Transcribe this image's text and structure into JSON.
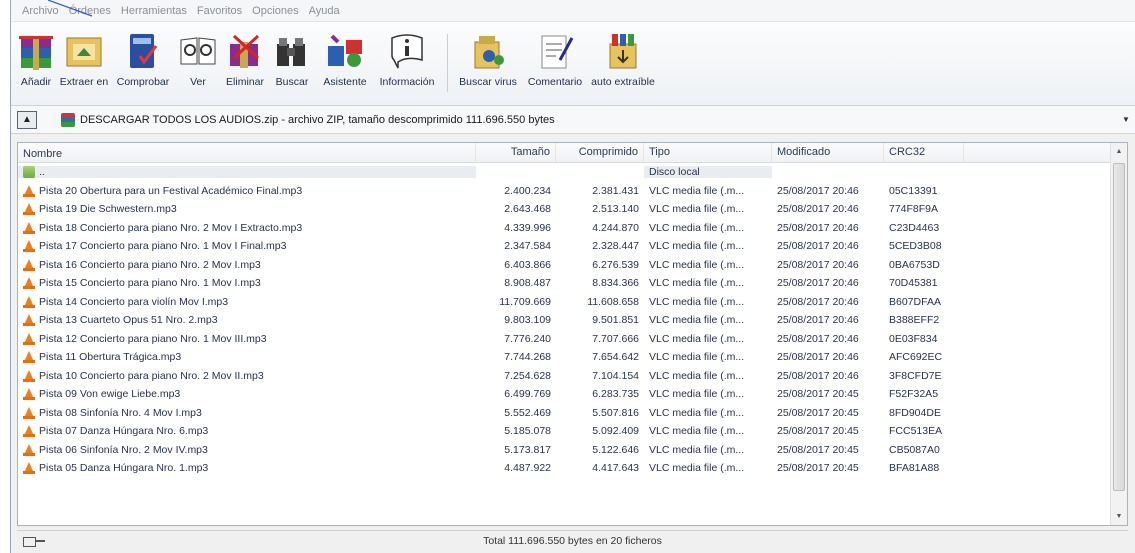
{
  "menu": [
    "Archivo",
    "Órdenes",
    "Herramientas",
    "Favoritos",
    "Opciones",
    "Ayuda"
  ],
  "toolbar": {
    "group1": [
      {
        "label": "Añadir",
        "icon": "add-archive-icon"
      },
      {
        "label": "Extraer en",
        "icon": "extract-icon"
      },
      {
        "label": "Comprobar",
        "icon": "test-icon"
      },
      {
        "label": "Ver",
        "icon": "view-icon"
      },
      {
        "label": "Eliminar",
        "icon": "delete-icon"
      },
      {
        "label": "Buscar",
        "icon": "find-icon"
      },
      {
        "label": "Asistente",
        "icon": "wizard-icon"
      },
      {
        "label": "Información",
        "icon": "info-icon"
      }
    ],
    "group2": [
      {
        "label": "Buscar virus",
        "icon": "virus-scan-icon"
      },
      {
        "label": "Comentario",
        "icon": "comment-icon"
      },
      {
        "label": "auto extraíble",
        "icon": "sfx-icon"
      }
    ]
  },
  "path": {
    "text": "DESCARGAR TODOS LOS AUDIOS.zip - archivo ZIP, tamaño descomprimido 111.696.550 bytes"
  },
  "columns": {
    "name": "Nombre",
    "size": "Tamaño",
    "compressed": "Comprimido",
    "type": "Tipo",
    "modified": "Modificado",
    "crc": "CRC32"
  },
  "parent_row": {
    "name": "..",
    "type": "Disco local"
  },
  "files": [
    {
      "name": "Pista 20 Obertura para un Festival Académico Final.mp3",
      "size": "2.400.234",
      "compressed": "2.381.431",
      "type": "VLC media file (.m...",
      "modified": "25/08/2017 20:46",
      "crc": "05C13391"
    },
    {
      "name": "Pista 19 Die Schwestern.mp3",
      "size": "2.643.468",
      "compressed": "2.513.140",
      "type": "VLC media file (.m...",
      "modified": "25/08/2017 20:46",
      "crc": "774F8F9A"
    },
    {
      "name": "Pista 18 Concierto para piano Nro. 2 Mov I Extracto.mp3",
      "size": "4.339.996",
      "compressed": "4.244.870",
      "type": "VLC media file (.m...",
      "modified": "25/08/2017 20:46",
      "crc": "C23D4463"
    },
    {
      "name": "Pista 17 Concierto para piano Nro. 1 Mov I Final.mp3",
      "size": "2.347.584",
      "compressed": "2.328.447",
      "type": "VLC media file (.m...",
      "modified": "25/08/2017 20:46",
      "crc": "5CED3B08"
    },
    {
      "name": "Pista 16 Concierto para piano Nro. 2 Mov I.mp3",
      "size": "6.403.866",
      "compressed": "6.276.539",
      "type": "VLC media file (.m...",
      "modified": "25/08/2017 20:46",
      "crc": "0BA6753D"
    },
    {
      "name": "Pista 15 Concierto para piano Nro. 1 Mov I.mp3",
      "size": "8.908.487",
      "compressed": "8.834.366",
      "type": "VLC media file (.m...",
      "modified": "25/08/2017 20:46",
      "crc": "70D45381"
    },
    {
      "name": "Pista 14 Concierto para violín Mov I.mp3",
      "size": "11.709.669",
      "compressed": "11.608.658",
      "type": "VLC media file (.m...",
      "modified": "25/08/2017 20:46",
      "crc": "B607DFAA"
    },
    {
      "name": "Pista 13 Cuarteto Opus 51 Nro. 2.mp3",
      "size": "9.803.109",
      "compressed": "9.501.851",
      "type": "VLC media file (.m...",
      "modified": "25/08/2017 20:46",
      "crc": "B388EFF2"
    },
    {
      "name": "Pista 12 Concierto para piano Nro. 1 Mov III.mp3",
      "size": "7.776.240",
      "compressed": "7.707.666",
      "type": "VLC media file (.m...",
      "modified": "25/08/2017 20:46",
      "crc": "0E03F834"
    },
    {
      "name": "Pista 11 Obertura Trágica.mp3",
      "size": "7.744.268",
      "compressed": "7.654.642",
      "type": "VLC media file (.m...",
      "modified": "25/08/2017 20:46",
      "crc": "AFC692EC"
    },
    {
      "name": "Pista 10 Concierto para piano Nro. 2 Mov II.mp3",
      "size": "7.254.628",
      "compressed": "7.104.154",
      "type": "VLC media file (.m...",
      "modified": "25/08/2017 20:46",
      "crc": "3F8CFD7E"
    },
    {
      "name": "Pista 09 Von ewige Liebe.mp3",
      "size": "6.499.769",
      "compressed": "6.283.735",
      "type": "VLC media file (.m...",
      "modified": "25/08/2017 20:45",
      "crc": "F52F32A5"
    },
    {
      "name": "Pista 08 Sinfonía Nro. 4 Mov I.mp3",
      "size": "5.552.469",
      "compressed": "5.507.816",
      "type": "VLC media file (.m...",
      "modified": "25/08/2017 20:45",
      "crc": "8FD904DE"
    },
    {
      "name": "Pista 07 Danza Húngara Nro. 6.mp3",
      "size": "5.185.078",
      "compressed": "5.092.409",
      "type": "VLC media file (.m...",
      "modified": "25/08/2017 20:45",
      "crc": "FCC513EA"
    },
    {
      "name": "Pista 06 Sinfonía Nro. 2 Mov IV.mp3",
      "size": "5.173.817",
      "compressed": "5.122.646",
      "type": "VLC media file (.m...",
      "modified": "25/08/2017 20:45",
      "crc": "CB5087A0"
    },
    {
      "name": "Pista 05 Danza Húngara Nro. 1.mp3",
      "size": "4.487.922",
      "compressed": "4.417.643",
      "type": "VLC media file (.m...",
      "modified": "25/08/2017 20:45",
      "crc": "BFA81A88"
    }
  ],
  "status": {
    "text": "Total 111.696.550 bytes en 20 ficheros"
  }
}
